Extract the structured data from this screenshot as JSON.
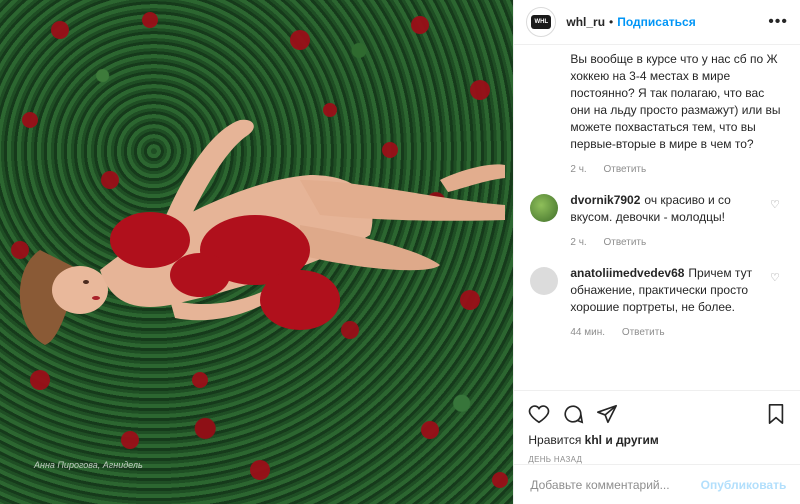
{
  "header": {
    "username": "whl_ru",
    "separator": "•",
    "follow_label": "Подписаться",
    "more_icon": "more-dots-icon",
    "avatar_text": "WHL"
  },
  "photo": {
    "credit": "Анна Пирогова, Агнидель"
  },
  "comments": [
    {
      "username": "",
      "text": "Вы вообще в курсе что у нас сб по Ж хоккею на 3-4 местах в мире постоянно? Я так полагаю, что вас они на льду просто размажут) или вы можете похвастаться тем, что вы первые-вторые в мире в чем то?",
      "time": "2 ч.",
      "reply": "Ответить"
    },
    {
      "username": "dvornik7902",
      "text": "оч красиво и со вкусом. девочки - молодцы!",
      "time": "2 ч.",
      "reply": "Ответить",
      "avatar_color": "#5a8a3a"
    },
    {
      "username": "anatoliimedvedev68",
      "text": "Причем тут обнажение, практически просто хорошие портреты, не более.",
      "time": "44 мин.",
      "reply": "Ответить",
      "avatar_color": "#dcdcdc"
    }
  ],
  "actions": {
    "likes_prefix": "Нравится",
    "likes_user": "khl",
    "likes_suffix": "и другим",
    "date": "ДЕНЬ НАЗАД"
  },
  "add_comment": {
    "placeholder": "Добавьте комментарий...",
    "publish_label": "Опубликовать"
  },
  "colors": {
    "accent": "#0095f6",
    "publish_disabled": "#b2dffc",
    "muted": "#8e8e8e"
  }
}
